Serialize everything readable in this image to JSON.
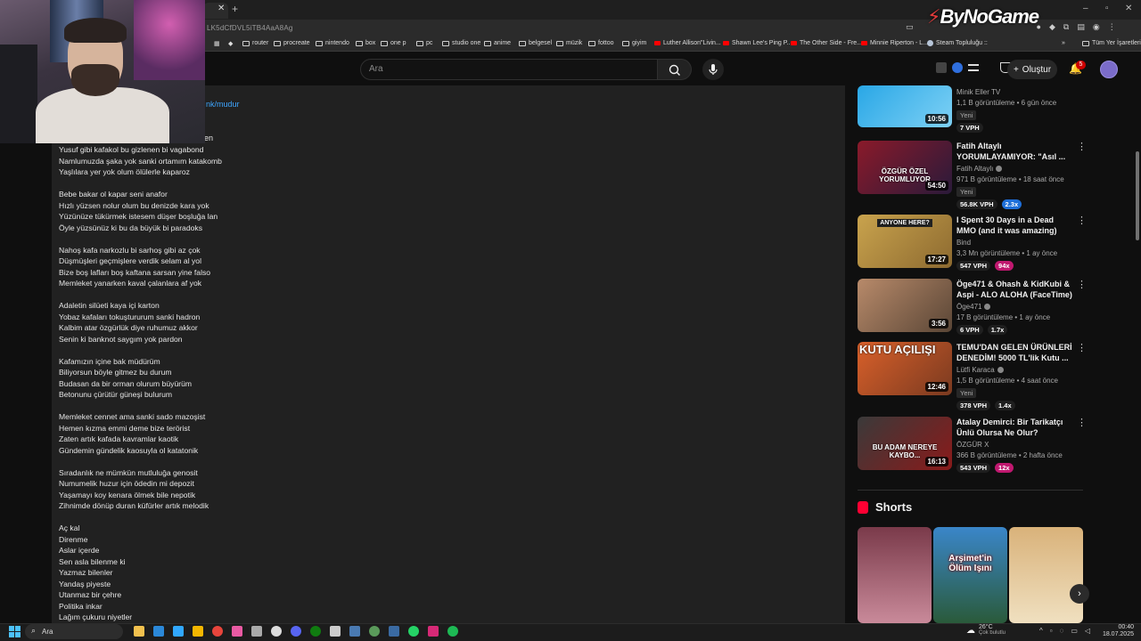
{
  "browser": {
    "url_fragment": "LK5dCfDVL5iTB4AaA8Ag",
    "extension_logo": "ByNoGame",
    "bookmarks": [
      {
        "label": "router",
        "icon": "folder"
      },
      {
        "label": "procreate",
        "icon": "folder"
      },
      {
        "label": "nintendo",
        "icon": "folder"
      },
      {
        "label": "box",
        "icon": "folder"
      },
      {
        "label": "one p",
        "icon": "folder"
      },
      {
        "label": "pc",
        "icon": "folder"
      },
      {
        "label": "studio one",
        "icon": "folder"
      },
      {
        "label": "anime",
        "icon": "folder"
      },
      {
        "label": "belgesel",
        "icon": "folder"
      },
      {
        "label": "müzik",
        "icon": "folder"
      },
      {
        "label": "fottoo",
        "icon": "folder"
      },
      {
        "label": "giyim",
        "icon": "folder"
      },
      {
        "label": "Luther Allison\"Livin...",
        "icon": "youtube"
      },
      {
        "label": "Shawn Lee's Ping P...",
        "icon": "youtube"
      },
      {
        "label": "The Other Side - Fre...",
        "icon": "youtube"
      },
      {
        "label": "Minnie Riperton - L...",
        "icon": "youtube"
      },
      {
        "label": "Steam Topluluğu ::",
        "icon": "steam"
      }
    ],
    "all_bookmarks": "Tüm Yer İşaretleri"
  },
  "header": {
    "search_placeholder": "Ara",
    "create_label": "Oluştur",
    "notifications_count": "5"
  },
  "description": {
    "link_fragment": "nk/mudur",
    "cut_fragment": "en",
    "stanzas": [
      [
        "Yusuf gibi kafakol bu gizlenen bi vagabond",
        "Namlumuzda şaka yok sanki ortamım katakomb",
        "Yaşlılara yer yok olum ölülerle kaparoz"
      ],
      [
        "Bebe bakar ol kapar seni anafor",
        "Hızlı yüzsen nolur olum bu denizde kara yok",
        "Yüzünüze tükürmek istesem düşer boşluğa lan",
        "Öyle yüzsünüz ki bu da büyük bi paradoks"
      ],
      [
        "Nahoş kafa narkozlu bi sarhoş gibi az çok",
        "Düşmüşleri geçmişlere verdik selam al yol",
        "Bize boş lafları boş kaftana sarsan yine falso",
        "Memleket yanarken kaval çalanlara af yok"
      ],
      [
        "Adaletin silüeti kaya içi karton",
        "Yobaz kafaları tokuştururum sanki hadron",
        "Kalbim atar özgürlük diye ruhumuz akkor",
        "Senin ki banknot saygım yok pardon"
      ],
      [
        "Kafamızın içine bak müdürüm",
        "Biliyorsun böyle gitmez bu durum",
        "Budasan da bir orman olurum büyürüm",
        "Betonunu çürütür güneşi bulurum"
      ],
      [
        "Memleket cennet ama sanki sado mazoşist",
        "Hemen kızma emmi deme bize terörist",
        "Zaten artık kafada kavramlar kaotik",
        "Gündemin gündelik kaosuyla ol katatonik"
      ],
      [
        "Sıradanlık ne mümkün mutluluğa genosit",
        "Numumelik huzur için ödedin mi depozit",
        "Yaşamayı koy kenara ölmek bile nepotik",
        "Zihnimde dönüp duran küfürler artık melodik"
      ],
      [
        "Aç kal",
        "Direnme",
        "Aslar içerde",
        "Sen asla bilenme ki",
        "Yazmaz bilenler",
        "Yandaş piyeste",
        "Utanmaz bir çehre",
        "Politika inkar",
        "Lağım çukuru niyetler"
      ]
    ]
  },
  "sidebar": {
    "videos": [
      {
        "title": "",
        "channel": "Minik Eller TV",
        "verified": false,
        "meta": "1,1 B görüntüleme • 6 gün önce",
        "badge_new": "Yeni",
        "vph": "7 VPH",
        "multiplier": "",
        "multiplier_color": "",
        "duration": "10:56",
        "thumb_text": "",
        "thumb_colors": [
          "#29a7e6",
          "#7ed1f5"
        ]
      },
      {
        "title": "Fatih Altaylı YORUMLAYAMIYOR: \"Asıl ...",
        "channel": "Fatih Altaylı",
        "verified": true,
        "meta": "971 B görüntüleme • 18 saat önce",
        "badge_new": "Yeni",
        "vph": "56.8K VPH",
        "multiplier": "2.3x",
        "multiplier_color": "#1e6fd9",
        "duration": "54:50",
        "thumb_text": "ÖZGÜR ÖZEL YORUMLUYOR",
        "thumb_colors": [
          "#8a1a2a",
          "#2a1a3a"
        ]
      },
      {
        "title": "I Spent 30 Days in a Dead MMO (and it was amazing)",
        "channel": "Bind",
        "verified": false,
        "meta": "3,3 Mn görüntüleme • 1 ay önce",
        "badge_new": "",
        "vph": "547 VPH",
        "multiplier": "94x",
        "multiplier_color": "#c0186f",
        "duration": "17:27",
        "thumb_text": "ANYONE HERE?",
        "thumb_colors": [
          "#c9a34d",
          "#8d6a30"
        ]
      },
      {
        "title": "Öge471 & Ohash & KidKubi & Aspi - ALO ALOHA (FaceTime)",
        "channel": "Öge471",
        "verified": true,
        "meta": "17 B görüntüleme • 1 ay önce",
        "badge_new": "",
        "vph": "6 VPH",
        "multiplier": "1.7x",
        "multiplier_color": "#1f1f1f",
        "duration": "3:56",
        "thumb_text": "",
        "thumb_colors": [
          "#b88a6a",
          "#5a4636"
        ]
      },
      {
        "title": "TEMU'DAN GELEN ÜRÜNLERİ DENEDİM! 5000 TL'lik Kutu ...",
        "channel": "Lütfi Karaca",
        "verified": true,
        "meta": "1,5 B görüntüleme • 4 saat önce",
        "badge_new": "Yeni",
        "vph": "378 VPH",
        "multiplier": "1.4x",
        "multiplier_color": "#1f1f1f",
        "duration": "12:46",
        "thumb_text": "KUTU AÇILIŞI",
        "thumb_colors": [
          "#d9602a",
          "#7a3a20"
        ]
      },
      {
        "title": "Atalay Demirci: Bir Tarikatçı Ünlü Olursa Ne Olur?",
        "channel": "ÖZGÜR X",
        "verified": false,
        "meta": "366 B görüntüleme • 2 hafta önce",
        "badge_new": "",
        "vph": "543 VPH",
        "multiplier": "12x",
        "multiplier_color": "#c0186f",
        "duration": "16:13",
        "thumb_text": "BU ADAM NEREYE KAYBO...",
        "thumb_colors": [
          "#3a3a3a",
          "#8a1a1a"
        ]
      }
    ],
    "shorts_title": "Shorts",
    "shorts": [
      {
        "caption": "",
        "colors": [
          "#7a3a4a",
          "#c98a9a"
        ]
      },
      {
        "caption": "Arşimet'in Ölüm Işını",
        "colors": [
          "#3a86c9",
          "#2a5a3a"
        ]
      },
      {
        "caption": "",
        "colors": [
          "#d9b27a",
          "#f0e0c0"
        ]
      }
    ]
  },
  "taskbar": {
    "search_placeholder": "Ara",
    "weather_temp": "26°C",
    "weather_desc": "Çok bulutlu",
    "time": "00:40",
    "date": "18.07.2025"
  }
}
